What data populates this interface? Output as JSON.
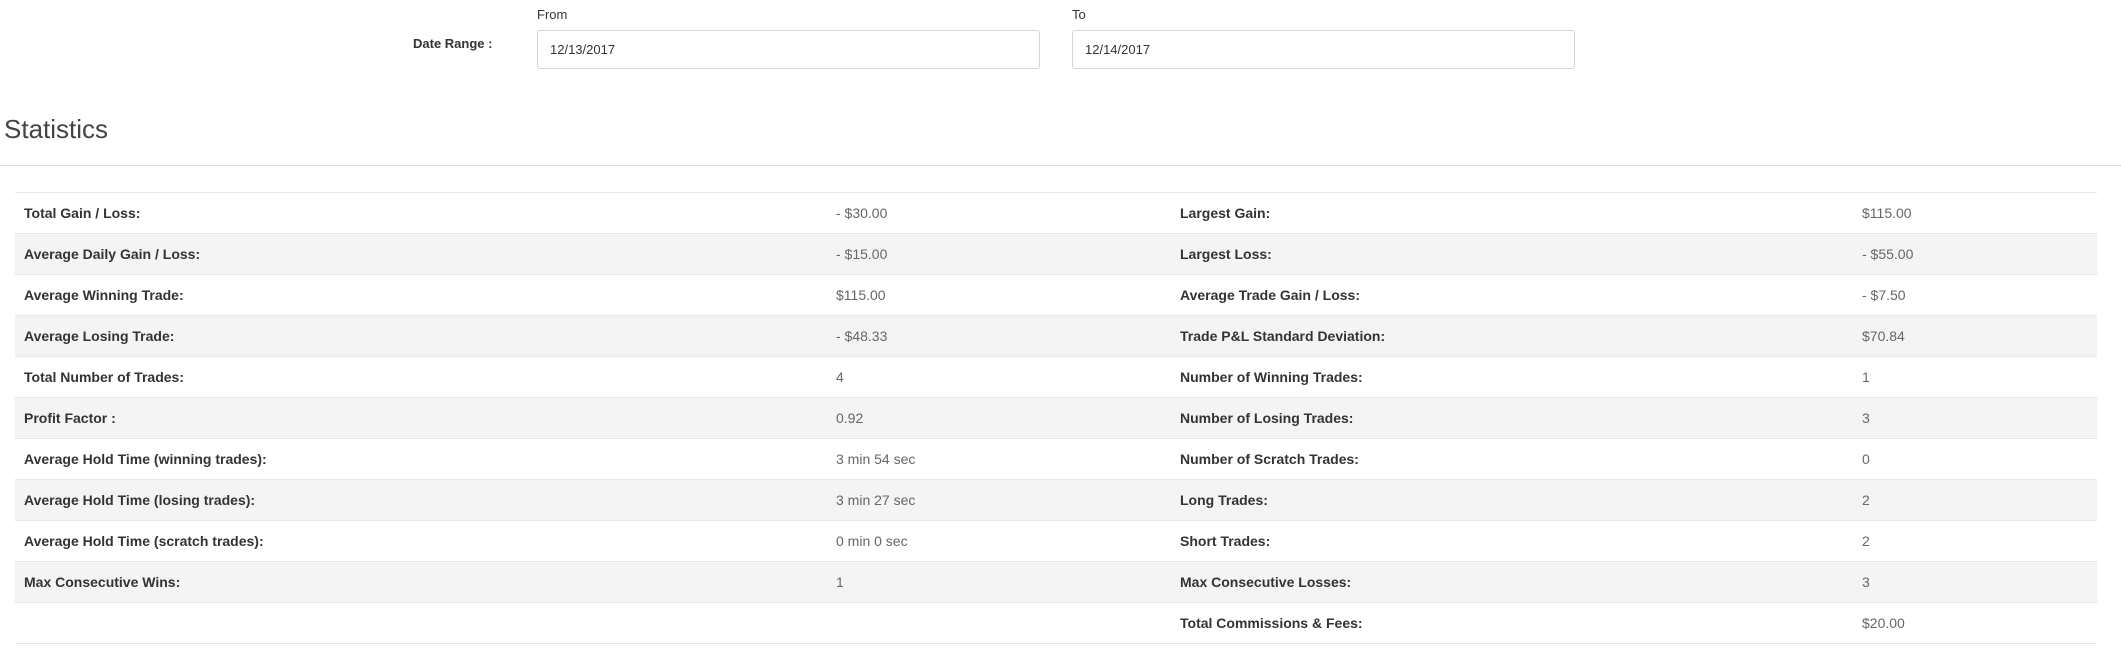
{
  "date_range": {
    "label": "Date Range :",
    "from_label": "From",
    "to_label": "To",
    "from_value": "12/13/2017",
    "to_value": "12/14/2017"
  },
  "section_title": "Statistics",
  "stats": [
    {
      "l1": "Total Gain / Loss:",
      "v1": "- $30.00",
      "l2": "Largest Gain:",
      "v2": "$115.00"
    },
    {
      "l1": "Average Daily Gain / Loss:",
      "v1": "- $15.00",
      "l2": "Largest Loss:",
      "v2": "- $55.00"
    },
    {
      "l1": "Average Winning Trade:",
      "v1": "$115.00",
      "l2": "Average Trade Gain / Loss:",
      "v2": "- $7.50"
    },
    {
      "l1": "Average Losing Trade:",
      "v1": "- $48.33",
      "l2": "Trade P&L Standard Deviation:",
      "v2": "$70.84"
    },
    {
      "l1": "Total Number of Trades:",
      "v1": "4",
      "l2": "Number of Winning Trades:",
      "v2": "1"
    },
    {
      "l1": "Profit Factor :",
      "v1": "0.92",
      "l2": "Number of Losing Trades:",
      "v2": "3"
    },
    {
      "l1": "Average Hold Time (winning trades):",
      "v1": "3 min 54 sec",
      "l2": "Number of Scratch Trades:",
      "v2": "0"
    },
    {
      "l1": "Average Hold Time (losing trades):",
      "v1": "3 min 27 sec",
      "l2": "Long Trades:",
      "v2": "2"
    },
    {
      "l1": "Average Hold Time (scratch trades):",
      "v1": "0 min 0 sec",
      "l2": "Short Trades:",
      "v2": "2"
    },
    {
      "l1": "Max Consecutive Wins:",
      "v1": "1",
      "l2": "Max Consecutive Losses:",
      "v2": "3"
    },
    {
      "l1": "",
      "v1": "",
      "l2": "Total Commissions & Fees:",
      "v2": "$20.00"
    }
  ]
}
